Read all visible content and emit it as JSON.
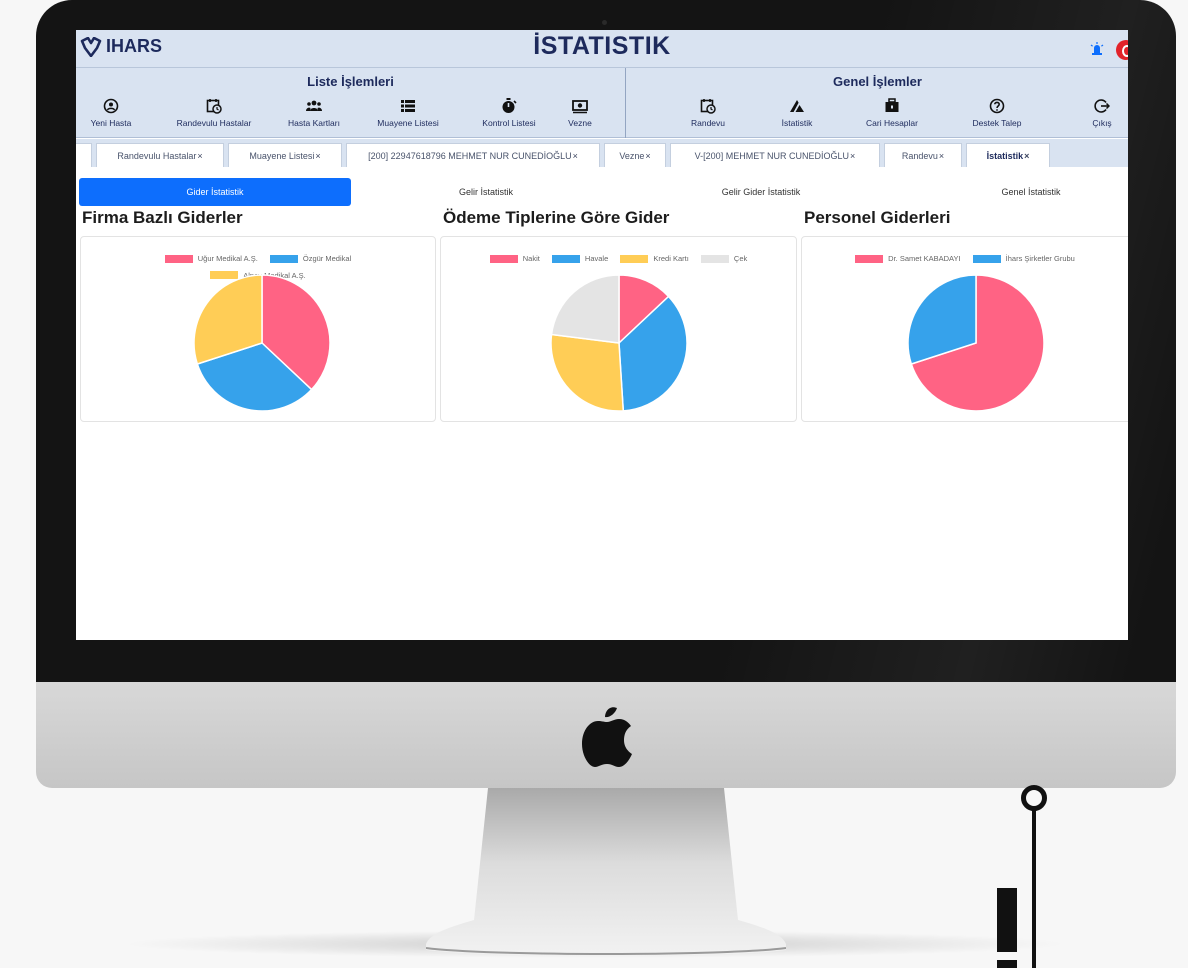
{
  "app": {
    "logo_text": "IHARS",
    "page_title": "İSTATISTIK"
  },
  "toolbar": {
    "left_group_title": "Liste İşlemleri",
    "right_group_title": "Genel İşlemler",
    "left_items": [
      {
        "label": "Yeni Hasta",
        "icon": "user-circle-icon"
      },
      {
        "label": "Randevulu Hastalar",
        "icon": "calendar-clock-icon"
      },
      {
        "label": "Hasta Kartları",
        "icon": "users-icon"
      },
      {
        "label": "Muayene Listesi",
        "icon": "list-icon"
      },
      {
        "label": "Kontrol Listesi",
        "icon": "stopwatch-icon"
      },
      {
        "label": "Vezne",
        "icon": "money-icon"
      }
    ],
    "right_items": [
      {
        "label": "Randevu",
        "icon": "calendar-clock-icon"
      },
      {
        "label": "İstatistik",
        "icon": "chart-icon"
      },
      {
        "label": "Cari Hesaplar",
        "icon": "briefcase-icon"
      },
      {
        "label": "Destek Talep",
        "icon": "question-icon"
      },
      {
        "label": "Çıkış",
        "icon": "logout-icon"
      }
    ]
  },
  "tabs": [
    {
      "label": "",
      "closable": false
    },
    {
      "label": "Randevulu Hastalar",
      "closable": true
    },
    {
      "label": "Muayene Listesi",
      "closable": true
    },
    {
      "label": "[200] 22947618796 MEHMET NUR CUNEDİOĞLU",
      "closable": true
    },
    {
      "label": "Vezne",
      "closable": true
    },
    {
      "label": "V-[200] MEHMET NUR CUNEDİOĞLU",
      "closable": true
    },
    {
      "label": "Randevu",
      "closable": true
    },
    {
      "label": "İstatistik",
      "closable": true,
      "active": true
    }
  ],
  "tab_close_glyph": "×",
  "subnav": [
    {
      "label": "Gider İstatistik",
      "active": true
    },
    {
      "label": "Gelir İstatistik",
      "active": false
    },
    {
      "label": "Gelir Gider İstatistik",
      "active": false
    },
    {
      "label": "Genel İstatistik",
      "active": false
    }
  ],
  "colors": {
    "pink": "#ff6384",
    "blue": "#36a2eb",
    "yellow": "#ffcd56",
    "grey": "#e4e4e4",
    "primary": "#0d6efd",
    "navy": "#1d2a5c"
  },
  "chart_data": [
    {
      "type": "pie",
      "title": "Firma Bazlı Giderler",
      "labels": [
        "Uğur Medikal A.Ş.",
        "Özgür Medikal",
        "Alpay Medikal A.Ş."
      ],
      "values": [
        37,
        33,
        30
      ],
      "colors": [
        "#ff6384",
        "#36a2eb",
        "#ffcd56"
      ],
      "legend": "top"
    },
    {
      "type": "pie",
      "title": "Ödeme Tiplerine Göre Gider",
      "labels": [
        "Nakit",
        "Havale",
        "Kredi Kartı",
        "Çek"
      ],
      "values": [
        13,
        36,
        28,
        23
      ],
      "colors": [
        "#ff6384",
        "#36a2eb",
        "#ffcd56",
        "#e4e4e4"
      ],
      "legend": "top"
    },
    {
      "type": "pie",
      "title": "Personel Giderleri",
      "labels": [
        "Dr. Samet KABADAYI",
        "İhars Şirketler Grubu"
      ],
      "values": [
        70,
        30
      ],
      "colors": [
        "#ff6384",
        "#36a2eb"
      ],
      "legend": "top"
    }
  ]
}
